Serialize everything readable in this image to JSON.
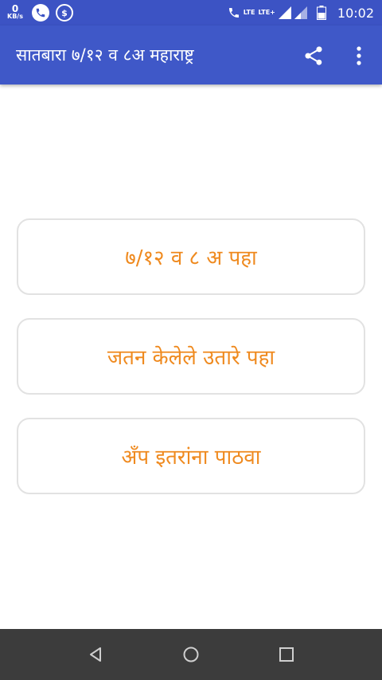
{
  "status_bar": {
    "net_speed_value": "0",
    "net_speed_unit": "KB/s",
    "dollar_symbol": "$",
    "lte_label_1": "LTE",
    "lte_label_2": "LTE+",
    "time": "10:02",
    "icons": [
      "phone-icon",
      "dollar-icon",
      "wifi-call-icon",
      "signal-icon",
      "battery-icon"
    ]
  },
  "app_bar": {
    "title": "सातबारा ७/१२ व ८अ महाराष्ट्र",
    "actions": [
      "share-icon",
      "overflow-menu-icon"
    ]
  },
  "menu": {
    "view_712": "७/१२ व ८ अ पहा",
    "saved_extracts": "जतन केलेले उतारे पहा",
    "share_app": "अँप इतरांना पाठवा"
  },
  "colors": {
    "app_bar": "#3f58c8",
    "status_bar": "#3c53c4",
    "button_text": "#ef8a1f",
    "button_border": "#e2e2e2",
    "nav_bar": "#3c3c3c"
  },
  "nav_bar": {
    "icons": [
      "back-icon",
      "home-icon",
      "recents-icon"
    ]
  }
}
